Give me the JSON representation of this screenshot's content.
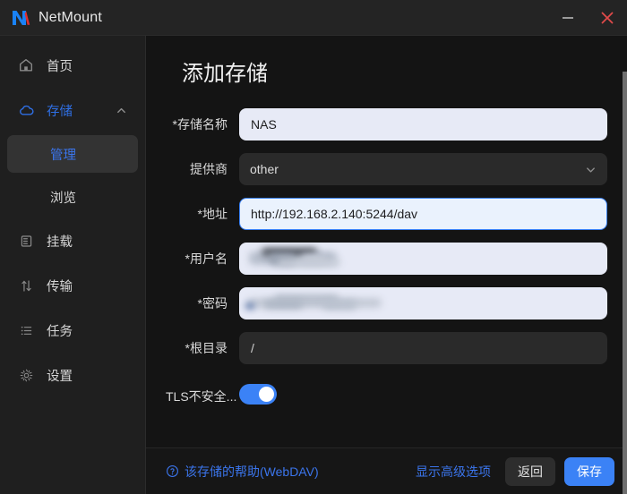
{
  "window": {
    "title": "NetMount",
    "logo_icon": "netmount-logo-icon",
    "minimize_label": "−",
    "close_label": "✕"
  },
  "sidebar": {
    "items": [
      {
        "label": "首页",
        "icon": "home-icon",
        "name": "home",
        "level": "top",
        "state": "normal"
      },
      {
        "label": "存储",
        "icon": "cloud-icon",
        "name": "storage",
        "level": "top",
        "state": "active-parent",
        "chevron": "chevron-up-icon"
      },
      {
        "label": "管理",
        "icon": "",
        "name": "manage",
        "level": "sub",
        "state": "selected"
      },
      {
        "label": "浏览",
        "icon": "",
        "name": "browse",
        "level": "sub",
        "state": "normal"
      },
      {
        "label": "挂载",
        "icon": "server-icon",
        "name": "mount",
        "level": "top",
        "state": "normal"
      },
      {
        "label": "传输",
        "icon": "transfer-icon",
        "name": "transfer",
        "level": "top",
        "state": "normal"
      },
      {
        "label": "任务",
        "icon": "list-icon",
        "name": "tasks",
        "level": "top",
        "state": "normal"
      },
      {
        "label": "设置",
        "icon": "gear-icon",
        "name": "settings",
        "level": "top",
        "state": "normal"
      }
    ]
  },
  "main": {
    "page_title": "添加存储",
    "fields": [
      {
        "name": "storage-name",
        "label": "*存储名称",
        "type": "text",
        "value": "NAS",
        "style": "light"
      },
      {
        "name": "provider",
        "label": "提供商",
        "type": "select",
        "value": "other",
        "style": "dark",
        "chevron": "chevron-down-icon"
      },
      {
        "name": "address",
        "label": "*地址",
        "type": "text",
        "value": "http://192.168.2.140:5244/dav",
        "style": "focused"
      },
      {
        "name": "username",
        "label": "*用户名",
        "type": "text",
        "value": "",
        "style": "light",
        "redacted": true
      },
      {
        "name": "password",
        "label": "*密码",
        "type": "password",
        "value": "",
        "style": "light",
        "redacted": true
      },
      {
        "name": "root-directory",
        "label": "*根目录",
        "type": "text",
        "value": "/",
        "style": "dark"
      }
    ],
    "toggle_field": {
      "name": "tls-insecure",
      "label": "TLS不安全...",
      "on": true
    }
  },
  "footer": {
    "help_icon": "question-circle-icon",
    "help_label": "该存储的帮助(WebDAV)",
    "advanced_label": "显示高级选项",
    "back_label": "返回",
    "save_label": "保存"
  },
  "colors": {
    "accent_blue": "#3b82f6",
    "link_blue": "#3b75ec",
    "close_red": "#e04a4a",
    "logo_blue": "#1a82f5",
    "logo_red": "#e03030",
    "sidebar_bg": "#1f1f1f",
    "main_bg": "#141414"
  }
}
